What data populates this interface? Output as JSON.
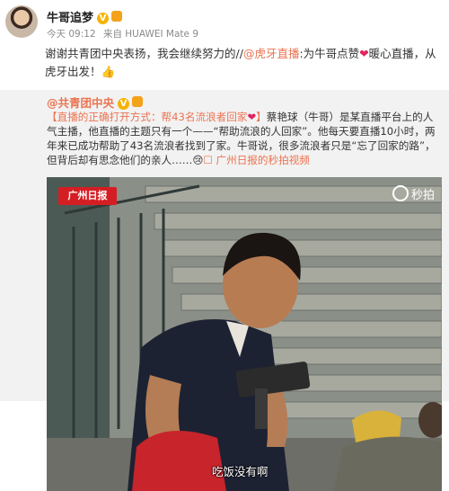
{
  "post": {
    "username": "牛哥追梦",
    "verified_badge": "V",
    "time": "今天 09:12",
    "source": "来自 HUAWEI Mate 9",
    "text_before": "谢谢共青团中央表扬，我会继续努力的//",
    "mention": "@虎牙直播",
    "text_mid": ":为牛哥点赞",
    "heart": "❤",
    "text_after": "暖心直播，从虎牙出发！",
    "emoji": "👍"
  },
  "repost": {
    "author": "@共青团中央",
    "headline": "【直播的正确打开方式：帮43名流浪者回家",
    "headline_heart": "❤",
    "headline_end": "】",
    "body": "蔡艳球（牛哥）是某直播平台上的人气主播，他直播的主题只有一个——“帮助流浪的人回家”。他每天要直播10小时，两年来已成功帮助了43名流浪者找到了家。牛哥说，很多流浪者只是“忘了回家的路”，但背后却有思念他们的亲人……",
    "emoji": "😢",
    "video_link": "☐ 广州日报的秒拍视频"
  },
  "video": {
    "logo_text": "广州日报",
    "watermark": "秒拍",
    "subtitle": "吃饭没有啊"
  },
  "colors": {
    "link": "#eb7350",
    "badge": "#f6b300",
    "repost_bg": "#f2f2f2",
    "logo_red": "#d41e23"
  }
}
